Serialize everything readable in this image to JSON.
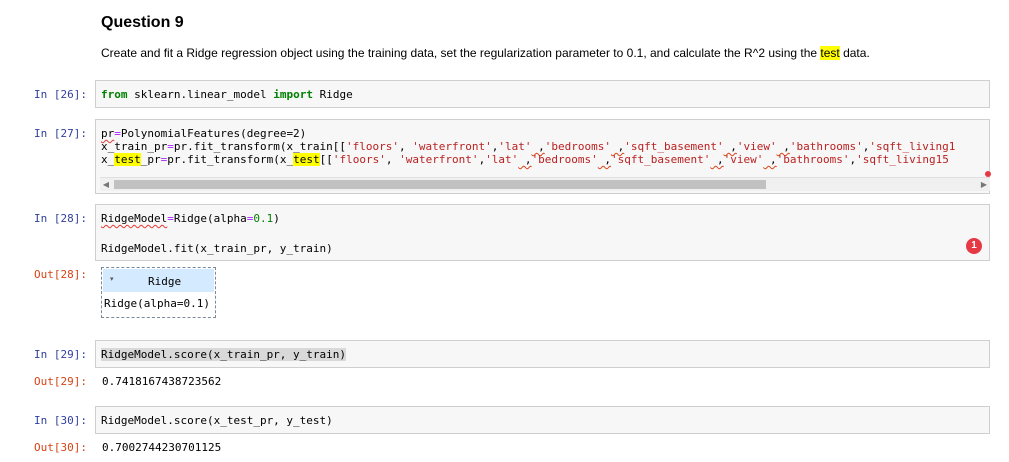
{
  "question": {
    "heading": "Question 9",
    "desc_before": "Create and fit a Ridge regression object using the training data, set the regularization parameter to 0.1, and calculate the R^2 using the ",
    "desc_highlight": "test",
    "desc_after": " data."
  },
  "cells": {
    "c26": {
      "prompt": "In [26]:",
      "kw_from": "from",
      "module": " sklearn.linear_model ",
      "kw_import": "import",
      "name": " Ridge"
    },
    "c27": {
      "prompt": "In [27]:",
      "l1_var": "pr",
      "l1_rest": "PolynomialFeatures(degree=2)",
      "l2_a": "x_train_pr",
      "l2_b": "pr.fit_transform(x_train[[",
      "s_floors": "'floors'",
      "s_waterfront": "'waterfront'",
      "s_lat": "'lat'",
      "s_bedrooms": "'bedrooms'",
      "s_sqft_basement": "'sqft_basement'",
      "s_view": "'view'",
      "s_bathrooms": "'bathrooms'",
      "s_sqft_living_cut": "'sqft_living1",
      "s_sqft_living15_cut": "'sqft_living15",
      "l3_x": "x_",
      "l3_test1": "test",
      "l3_mid": "_pr",
      "l3_b": "pr.fit_transform(x_",
      "l3_test2": "test",
      "l3_c": "[["
    },
    "c28": {
      "prompt": "In [28]:",
      "l1_var": "RidgeModel",
      "l1_call": "Ridge(alpha",
      "l1_val": "0.1",
      "l1_end": ")",
      "l2": "RidgeModel.fit(x_train_pr, y_train)",
      "out_prompt": "Out[28]:",
      "widget_title": "Ridge",
      "widget_caret": "▾",
      "widget_body": "Ridge(alpha=0.1)",
      "badge": "1"
    },
    "c29": {
      "prompt": "In [29]:",
      "code": "RidgeModel.score(x_train_pr, y_train)",
      "out_prompt": "Out[29]:",
      "out": "0.7418167438723562"
    },
    "c30": {
      "prompt": "In [30]:",
      "code": "RidgeModel.score(x_test_pr, y_test)",
      "out_prompt": "Out[30]:",
      "out": "0.7002744230701125"
    }
  },
  "scrollbar": {
    "left_arrow": "◀",
    "right_arrow": "▶"
  },
  "colors": {
    "prompt_in": "#303f9f",
    "prompt_out": "#d84315",
    "keyword": "#008000",
    "string": "#ba2121",
    "highlight": "#ffff00",
    "badge": "#e53945"
  }
}
